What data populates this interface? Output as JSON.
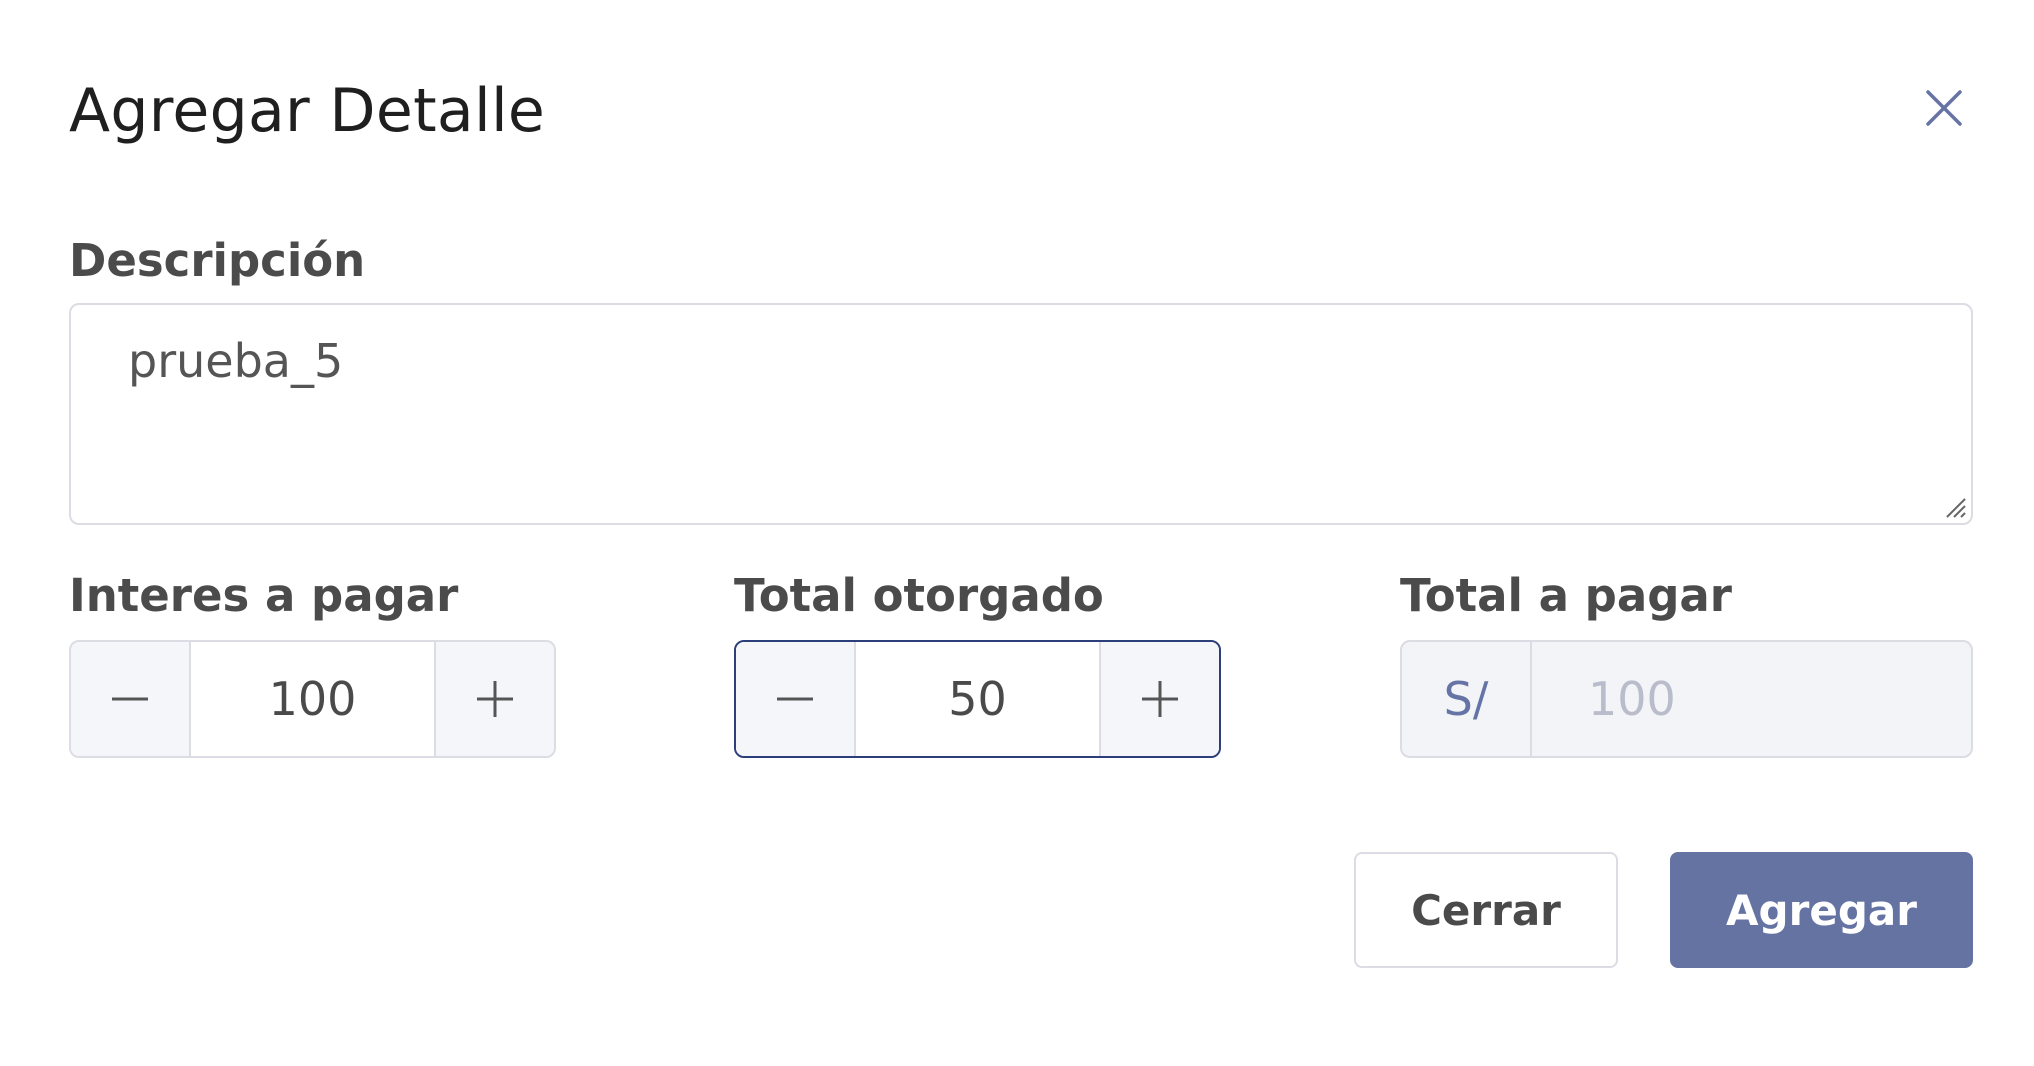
{
  "dialog": {
    "title": "Agregar Detalle",
    "close_icon": "close-icon"
  },
  "descripcion": {
    "label": "Descripción",
    "value": "prueba_5"
  },
  "interes": {
    "label": "Interes a pagar",
    "value": "100",
    "minus_icon": "minus-icon",
    "plus_icon": "plus-icon"
  },
  "otorgado": {
    "label": "Total otorgado",
    "value": "50",
    "focused": true,
    "minus_icon": "minus-icon",
    "plus_icon": "plus-icon"
  },
  "total": {
    "label": "Total a pagar",
    "prefix": "S/",
    "value": "100",
    "disabled": true
  },
  "buttons": {
    "cerrar": "Cerrar",
    "agregar": "Agregar"
  },
  "colors": {
    "primary": "#6573a3",
    "focus_border": "#2d3f7a",
    "border": "#dcdce4",
    "title_text": "#1f1f1f"
  }
}
